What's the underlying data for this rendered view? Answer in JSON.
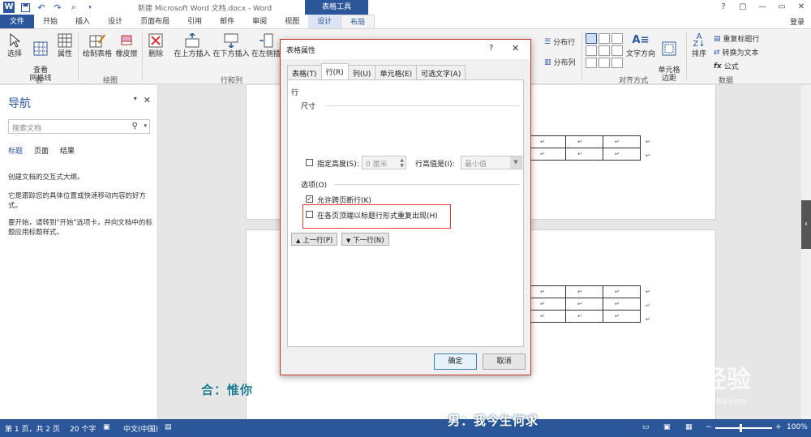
{
  "window": {
    "title": "新建 Microsoft Word 文档.docx - Word",
    "context_title": "表格工具",
    "controls": [
      "?",
      "▢",
      "—",
      "▭",
      "✕"
    ]
  },
  "tabs": [
    "文件",
    "开始",
    "插入",
    "设计",
    "页面布局",
    "引用",
    "邮件",
    "审阅",
    "视图",
    "设计",
    "布局"
  ],
  "login": "登录",
  "ribbon": {
    "select": "选择",
    "gridlines": "查看\n网格线",
    "properties": "属性",
    "draw_table": "绘制表格",
    "eraser": "橡皮擦",
    "delete": "删除",
    "insert_above": "在上方插入",
    "insert_below": "在下方插入",
    "insert_left": "在左侧插",
    "distribute_rows": "分布行",
    "distribute_cols": "分布列",
    "text_direction": "文字方向",
    "cell_margins": "单元格\n边距",
    "sort": "排序",
    "repeat_header": "重复标题行",
    "convert_text": "转换为文本",
    "formula": "公式",
    "group_table": "表",
    "group_draw": "绘图",
    "group_rows_cols": "行和列",
    "group_align": "对齐方式",
    "group_data": "数据"
  },
  "nav": {
    "title": "导航",
    "search_placeholder": "搜索文档",
    "tabs": [
      "标题",
      "页面",
      "结果"
    ],
    "text1": "创建文档的交互式大纲。",
    "text2": "它是跟踪您的具体位置或快速移动内容的好方式。",
    "text3": "要开始，请转到\"开始\"选项卡，并向文档中的标题应用标题样式。"
  },
  "dialog": {
    "title": "表格属性",
    "help": "?",
    "close": "✕",
    "tabs": [
      "表格(T)",
      "行(R)",
      "列(U)",
      "单元格(E)",
      "可选文字(A)"
    ],
    "section_row": "行",
    "section_size": "尺寸",
    "specify_height": "指定高度(S):",
    "height_value": "0 厘米",
    "row_height_is": "行高值是(I):",
    "row_height_mode": "最小值",
    "section_options": "选项(O)",
    "allow_break": "允许跨页断行(K)",
    "repeat_header": "在各页顶端以标题行形式重复出现(H)",
    "prev_row": "上一行(P)",
    "next_row": "下一行(N)",
    "ok": "确定",
    "cancel": "取消"
  },
  "doc": {
    "cell_mark": "↵",
    "subtitle1": "合：惟你",
    "subtitle2": "男：我今生何求"
  },
  "status": {
    "page": "第 1 页，共 2 页",
    "words": "20 个字",
    "lang": "中文(中国)",
    "zoom": "100%"
  },
  "watermark": {
    "brand": "Bai  经验",
    "url": "jingyan.baidu.com"
  },
  "colors": {
    "accent": "#2b579a",
    "highlight": "#e03a3a"
  }
}
